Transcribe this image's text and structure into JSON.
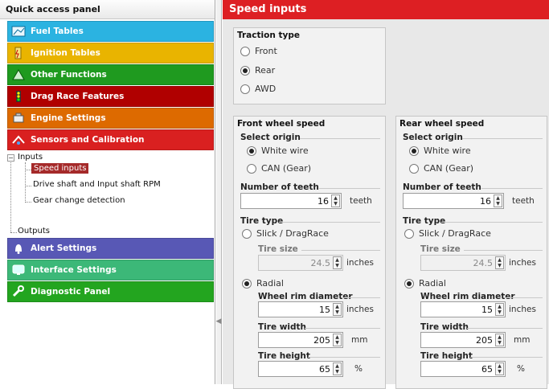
{
  "left_panel": {
    "title": "Quick access panel",
    "categories": [
      {
        "label": "Fuel Tables",
        "color": "#2bb3e1",
        "icon": "fuel-table-icon"
      },
      {
        "label": "Ignition Tables",
        "color": "#e9b400",
        "icon": "ignition-icon"
      },
      {
        "label": "Other Functions",
        "color": "#1f9a1f",
        "icon": "other-functions-icon"
      },
      {
        "label": "Drag Race Features",
        "color": "#b00000",
        "icon": "drag-race-icon"
      },
      {
        "label": "Engine Settings",
        "color": "#dd6a00",
        "icon": "engine-icon"
      },
      {
        "label": "Sensors and Calibration",
        "color": "#d92020",
        "icon": "sensors-icon"
      }
    ],
    "tree": {
      "inputs": "Inputs",
      "speed_inputs": "Speed inputs",
      "drive_shaft": "Drive shaft and Input shaft RPM",
      "gear_change": "Gear change detection",
      "outputs": "Outputs",
      "expander": "−"
    },
    "categories_bottom": [
      {
        "label": "Alert Settings",
        "color": "#5858b5",
        "icon": "bell-icon"
      },
      {
        "label": "Interface Settings",
        "color": "#3cb878",
        "icon": "monitor-icon"
      },
      {
        "label": "Diagnostic Panel",
        "color": "#23a51f",
        "icon": "wrench-icon"
      }
    ]
  },
  "right_panel": {
    "header": "Speed inputs",
    "traction": {
      "title": "Traction type",
      "options": [
        "Front",
        "Rear",
        "AWD"
      ],
      "selected": "Rear"
    },
    "front": {
      "title": "Front wheel speed",
      "select_origin": "Select origin",
      "origin_options": [
        "White wire",
        "CAN (Gear)"
      ],
      "origin_selected": "White wire",
      "teeth_label": "Number of teeth",
      "teeth_value": "16",
      "teeth_unit": "teeth",
      "tire_type": "Tire type",
      "slick_label": "Slick / DragRace",
      "tire_size_label": "Tire size",
      "tire_size_value": "24.5",
      "tire_size_unit": "inches",
      "radial_label": "Radial",
      "rim_label": "Wheel rim diameter",
      "rim_value": "15",
      "rim_unit": "inches",
      "width_label": "Tire width",
      "width_value": "205",
      "width_unit": "mm",
      "height_label": "Tire height",
      "height_value": "65",
      "height_unit": "%"
    },
    "rear": {
      "title": "Rear wheel speed",
      "select_origin": "Select origin",
      "origin_options": [
        "White wire",
        "CAN (Gear)"
      ],
      "origin_selected": "White wire",
      "teeth_label": "Number of teeth",
      "teeth_value": "16",
      "teeth_unit": "teeth",
      "tire_type": "Tire type",
      "slick_label": "Slick / DragRace",
      "tire_size_label": "Tire size",
      "tire_size_value": "24.5",
      "tire_size_unit": "inches",
      "radial_label": "Radial",
      "rim_label": "Wheel rim diameter",
      "rim_value": "15",
      "rim_unit": "inches",
      "width_label": "Tire width",
      "width_value": "205",
      "width_unit": "mm",
      "height_label": "Tire height",
      "height_value": "65",
      "height_unit": "%"
    }
  }
}
